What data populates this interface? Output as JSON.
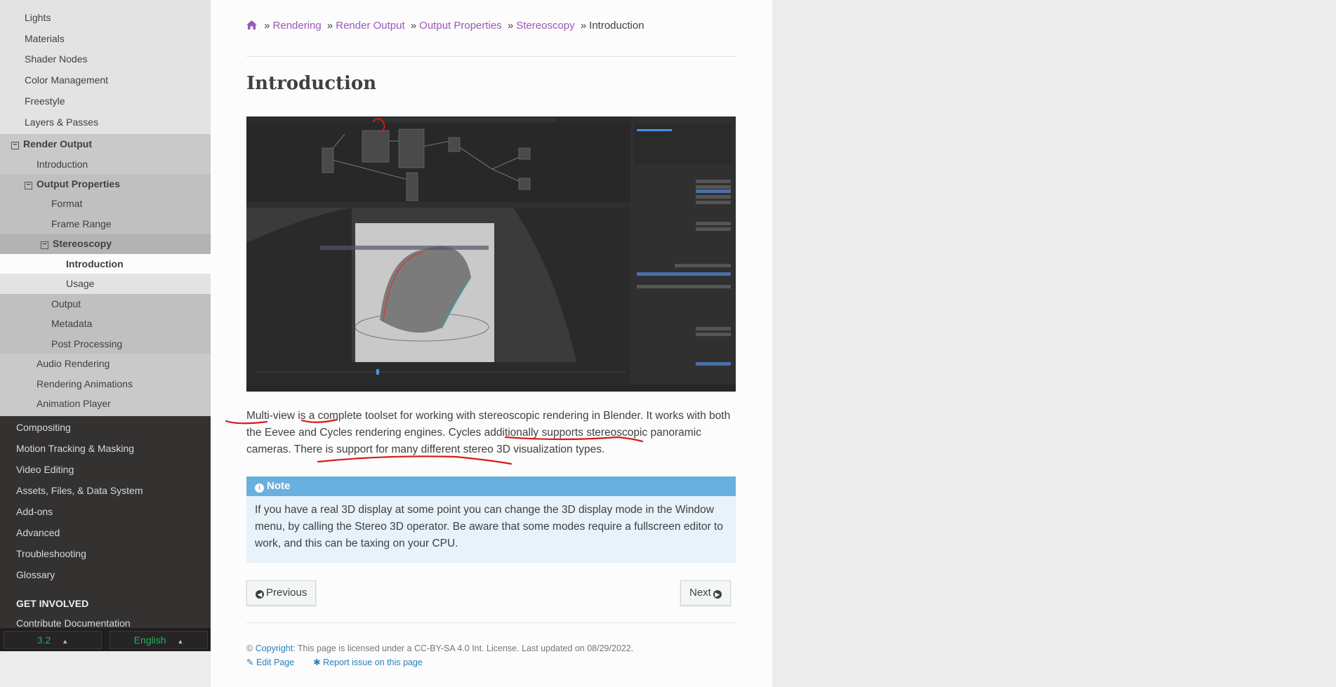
{
  "sidebar": {
    "top_items": [
      "Lights",
      "Materials",
      "Shader Nodes",
      "Color Management",
      "Freestyle",
      "Layers & Passes"
    ],
    "render_output": "Render Output",
    "ro_intro": "Introduction",
    "output_properties": "Output Properties",
    "op_items": [
      "Format",
      "Frame Range"
    ],
    "stereoscopy": "Stereoscopy",
    "st_intro": "Introduction",
    "st_usage": "Usage",
    "op_items2": [
      "Output",
      "Metadata",
      "Post Processing"
    ],
    "ro_items2": [
      "Audio Rendering",
      "Rendering Animations",
      "Animation Player"
    ],
    "dark_items": [
      "Compositing",
      "Motion Tracking & Masking",
      "Video Editing",
      "Assets, Files, & Data System",
      "Add-ons",
      "Advanced",
      "Troubleshooting",
      "Glossary"
    ],
    "caption": "GET INVOLVED",
    "contribute": "Contribute Documentation",
    "version": "3.2",
    "language": "English"
  },
  "breadcrumb": {
    "home_icon": "home-icon",
    "items": [
      "Rendering",
      "Render Output",
      "Output Properties",
      "Stereoscopy"
    ],
    "current": "Introduction",
    "separator": "»"
  },
  "title": "Introduction",
  "paragraph": "Multi-view is a complete toolset for working with stereoscopic rendering in Blender. It works with both the Eevee and Cycles rendering engines. Cycles additionally supports stereoscopic panoramic cameras. There is support for many different stereo 3D visualization types.",
  "note": {
    "title": "Note",
    "icon": "info-icon",
    "text": "If you have a real 3D display at some point you can change the 3D display mode in the Window menu, by calling the Stereo 3D operator. Be aware that some modes require a fullscreen editor to work, and this can be taxing on your CPU."
  },
  "nav": {
    "previous": "Previous",
    "next": "Next"
  },
  "footer": {
    "copyright_symbol": "©",
    "copyright_link": "Copyright",
    "license_text": ": This page is licensed under a CC-BY-SA 4.0 Int. License. Last updated on 08/29/2022.",
    "edit": "Edit Page",
    "report": "Report issue on this page"
  },
  "colors": {
    "link": "#9b59b6",
    "note_header": "#6ab0de",
    "note_bg": "#e7f2fa",
    "sidebar_dark": "#343131",
    "version_green": "#27ae60",
    "annotation": "#d61a1a"
  }
}
